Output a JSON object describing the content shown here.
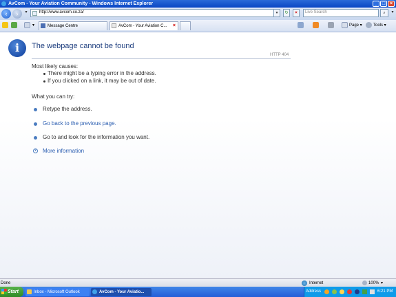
{
  "window": {
    "title": "AvCom - Your Aviation Community - Windows Internet Explorer"
  },
  "address_bar": {
    "url": "http://www.avcom.co.za/"
  },
  "search": {
    "placeholder": "Live Search"
  },
  "tabs": [
    {
      "label": "Message Centre",
      "active": false
    },
    {
      "label": "AvCom - Your Aviation C...",
      "active": true
    }
  ],
  "toolbar": {
    "page_label": "Page",
    "tools_label": "Tools"
  },
  "content": {
    "title": "The webpage cannot be found",
    "error_code": "HTTP 404",
    "causes_heading": "Most likely causes:",
    "causes": [
      "There might be a typing error in the address.",
      "If you clicked on a link, it may be out of date."
    ],
    "try_heading": "What you can try:",
    "actions": [
      {
        "text": "Retype the address.",
        "link": false
      },
      {
        "text": "Go back to the previous page.",
        "link": true
      },
      {
        "text": "Go to  and look for the information you want.",
        "link": false
      }
    ],
    "more_info": "More information"
  },
  "status_bar": {
    "status": "Done",
    "zone": "Internet",
    "zoom": "100%"
  },
  "taskbar": {
    "start": "Start",
    "tasks": [
      {
        "label": "Inbox - Microsoft Outlook",
        "active": false
      },
      {
        "label": "AvCom - Your Aviatio...",
        "active": true
      }
    ],
    "address_label": "Address",
    "clock": "6:21 PM"
  },
  "colors": {
    "title_blue": "#1f3f7f",
    "link_blue": "#2a5db0",
    "taskbar_blue": "#245ed8",
    "start_green": "#2f8a26"
  }
}
